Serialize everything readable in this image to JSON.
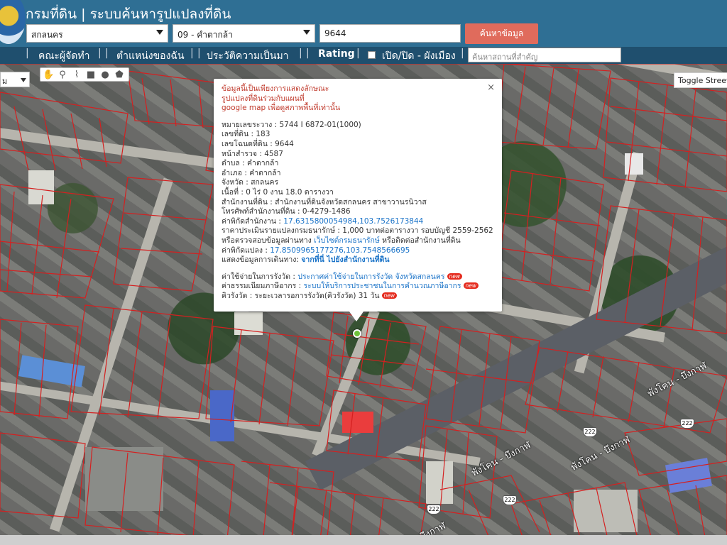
{
  "header": {
    "title": "กรมที่ดิน | ระบบค้นหารูปแปลงที่ดิน",
    "province": "สกลนคร",
    "district": "09 - คำตากล้า",
    "parcel_no": "9644",
    "search_button": "ค้นหาข้อมูล"
  },
  "nav": {
    "items": [
      "คณะผู้จัดทำ",
      "ตำแหน่งของฉัน",
      "ประวัติความเป็นมา",
      "Rating",
      "เปิด/ปิด - ผังเมือง"
    ],
    "place_placeholder": "ค้นหาสถานที่สำคัญ"
  },
  "map": {
    "type_label": "ม",
    "toggle_street": "Toggle Street View",
    "road_labels": [
      "พังโคน - บึงกาฬ",
      "พังโคน - บึงกาฬ",
      "พังโคน - บึงกาฬ",
      "บึงกาฬ"
    ],
    "route_numbers": [
      "222",
      "222",
      "222",
      "222"
    ]
  },
  "info": {
    "close": "×",
    "warning_lines": [
      "ข้อมูลนี้เป็นเพียงการแสดงลักษณะ",
      "รูปแปลงที่ดินร่วมกับแผนที่",
      "google map เพื่อดูสภาพพื้นที่เท่านั้น"
    ],
    "sheet": "หมายเลขระวาง : 5744 I 6872-01(1000)",
    "land_no": "เลขที่ดิน : 183",
    "deed_no": "เลขโฉนดที่ดิน : 9644",
    "survey_page": "หน้าสำรวจ : 4587",
    "subdistrict": "ตำบล : คำตากล้า",
    "district": "อำเภอ : คำตากล้า",
    "province": "จังหวัด : สกลนคร",
    "area": "เนื้อที่ : 0 ไร่ 0 งาน 18.0 ตารางวา",
    "office": "สำนักงานที่ดิน : สำนักงานที่ดินจังหวัดสกลนคร สาขาวานรนิวาส",
    "phone": "โทรศัพท์สำนักงานที่ดิน : 0-4279-1486",
    "office_coord_label": "ค่าพิกัดสำนักงาน : ",
    "office_coord": "17.6315800054984,103.7526173844",
    "price": "ราคาประเมินรายแปลงกรมธนารักษ์ : 1,000 บาทต่อตารางวา รอบบัญชี 2559-2562",
    "check_prefix": "หรือตรวจสอบข้อมูลผ่านทาง ",
    "check_link": "เว็บไซต์กรมธนารักษ์",
    "check_suffix": " หรือติดต่อสำนักงานที่ดิน",
    "parcel_coord_label": "ค่าพิกัดแปลง : ",
    "parcel_coord": "17.8509965177276,103.7548566695",
    "route_label": "แสดงข้อมูลการเดินทาง: ",
    "route_link": "จากที่นี่ ไปยังสำนักงานที่ดิน",
    "reg_cost_label": "ค่าใช้จ่ายในการรังวัด : ",
    "reg_cost_link": "ประกาศค่าใช้จ่ายในการรังวัด จังหวัดสกลนคร",
    "fee_label": "ค่าธรรมเนียมภาษีอากร : ",
    "fee_link": "ระบบให้บริการประชาชนในการคำนวณภาษีอากร",
    "queue_label": "คิวรังวัด : ระยะเวลารอการรังวัด(คิวรังวัด) 31 วัน",
    "new_badge": "new"
  }
}
